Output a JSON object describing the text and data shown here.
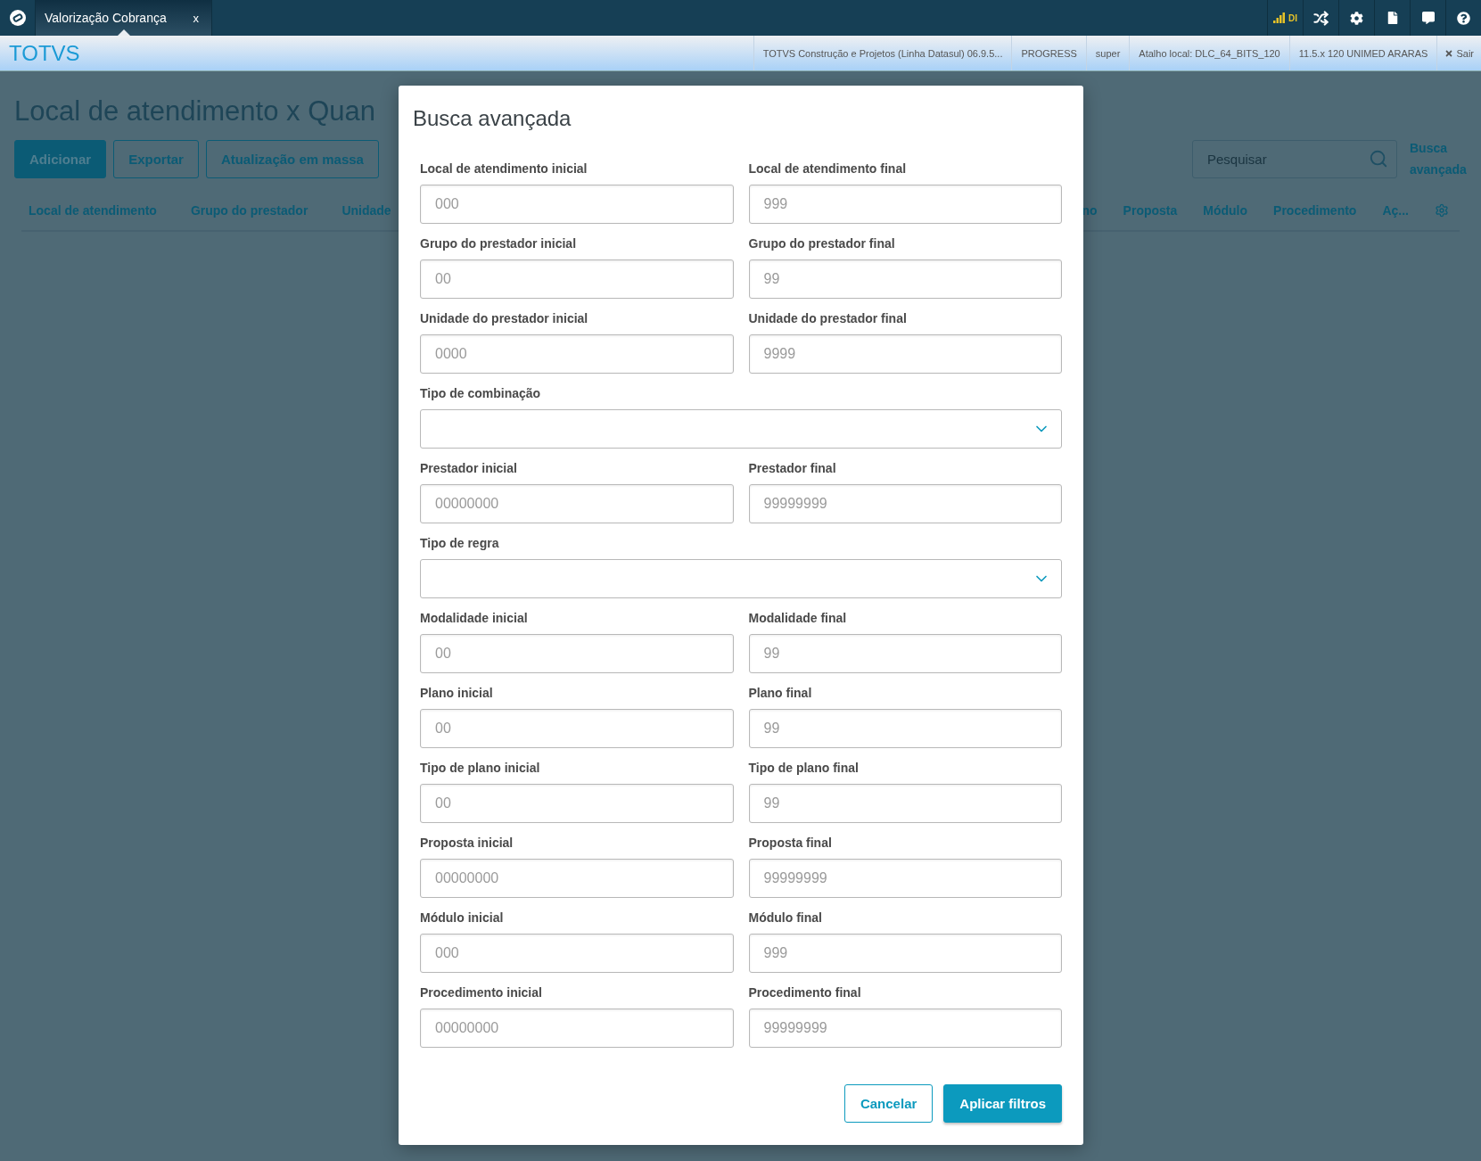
{
  "top_bar": {
    "tabs": [
      {
        "label": "Valorização Cobrança",
        "close": "x",
        "selected": true
      }
    ],
    "network_label": "DI"
  },
  "header": {
    "brand": "TOTVS",
    "info": [
      "TOTVS Construção e Projetos (Linha Datasul) 06.9.5...",
      "PROGRESS",
      "super",
      "Atalho local: DLC_64_BITS_120",
      "11.5.x 120 UNIMED ARARAS"
    ],
    "logout": "Sair"
  },
  "page": {
    "title": "Local de atendimento x Quan",
    "actions": [
      {
        "label": "Adicionar",
        "kind": "primary"
      },
      {
        "label": "Exportar",
        "kind": "secondary"
      },
      {
        "label": "Atualização em massa",
        "kind": "secondary"
      }
    ],
    "search": {
      "placeholder": "Pesquisar"
    },
    "advanced_link": "Busca avançada",
    "columns_left": [
      "Local de atendimento",
      "Grupo do prestador",
      "Unidade"
    ],
    "columns_right": [
      "no",
      "Proposta",
      "Módulo",
      "Procedimento",
      "Aç..."
    ]
  },
  "dialog": {
    "title": "Busca avançada",
    "fields": [
      {
        "kind": "range",
        "start": {
          "label": "Local de atendimento inicial",
          "placeholder": "000"
        },
        "end": {
          "label": "Local de atendimento final",
          "placeholder": "999"
        }
      },
      {
        "kind": "range",
        "start": {
          "label": "Grupo do prestador inicial",
          "placeholder": "00"
        },
        "end": {
          "label": "Grupo do prestador final",
          "placeholder": "99"
        }
      },
      {
        "kind": "range",
        "start": {
          "label": "Unidade do prestador inicial",
          "placeholder": "0000"
        },
        "end": {
          "label": "Unidade do prestador final",
          "placeholder": "9999"
        }
      },
      {
        "kind": "select",
        "label": "Tipo de combinação"
      },
      {
        "kind": "range",
        "start": {
          "label": "Prestador inicial",
          "placeholder": "00000000"
        },
        "end": {
          "label": "Prestador final",
          "placeholder": "99999999"
        }
      },
      {
        "kind": "select",
        "label": "Tipo de regra"
      },
      {
        "kind": "range",
        "start": {
          "label": "Modalidade inicial",
          "placeholder": "00"
        },
        "end": {
          "label": "Modalidade final",
          "placeholder": "99"
        }
      },
      {
        "kind": "range",
        "start": {
          "label": "Plano inicial",
          "placeholder": "00"
        },
        "end": {
          "label": "Plano final",
          "placeholder": "99"
        }
      },
      {
        "kind": "range",
        "start": {
          "label": "Tipo de plano inicial",
          "placeholder": "00"
        },
        "end": {
          "label": "Tipo de plano final",
          "placeholder": "99"
        }
      },
      {
        "kind": "range",
        "start": {
          "label": "Proposta inicial",
          "placeholder": "00000000"
        },
        "end": {
          "label": "Proposta final",
          "placeholder": "99999999"
        }
      },
      {
        "kind": "range",
        "start": {
          "label": "Módulo inicial",
          "placeholder": "000"
        },
        "end": {
          "label": "Módulo final",
          "placeholder": "999"
        }
      },
      {
        "kind": "range",
        "start": {
          "label": "Procedimento inicial",
          "placeholder": "00000000"
        },
        "end": {
          "label": "Procedimento final",
          "placeholder": "99999999"
        }
      }
    ],
    "buttons": [
      {
        "label": "Cancelar",
        "kind": "secondary"
      },
      {
        "label": "Aplicar filtros",
        "kind": "primary"
      }
    ]
  }
}
